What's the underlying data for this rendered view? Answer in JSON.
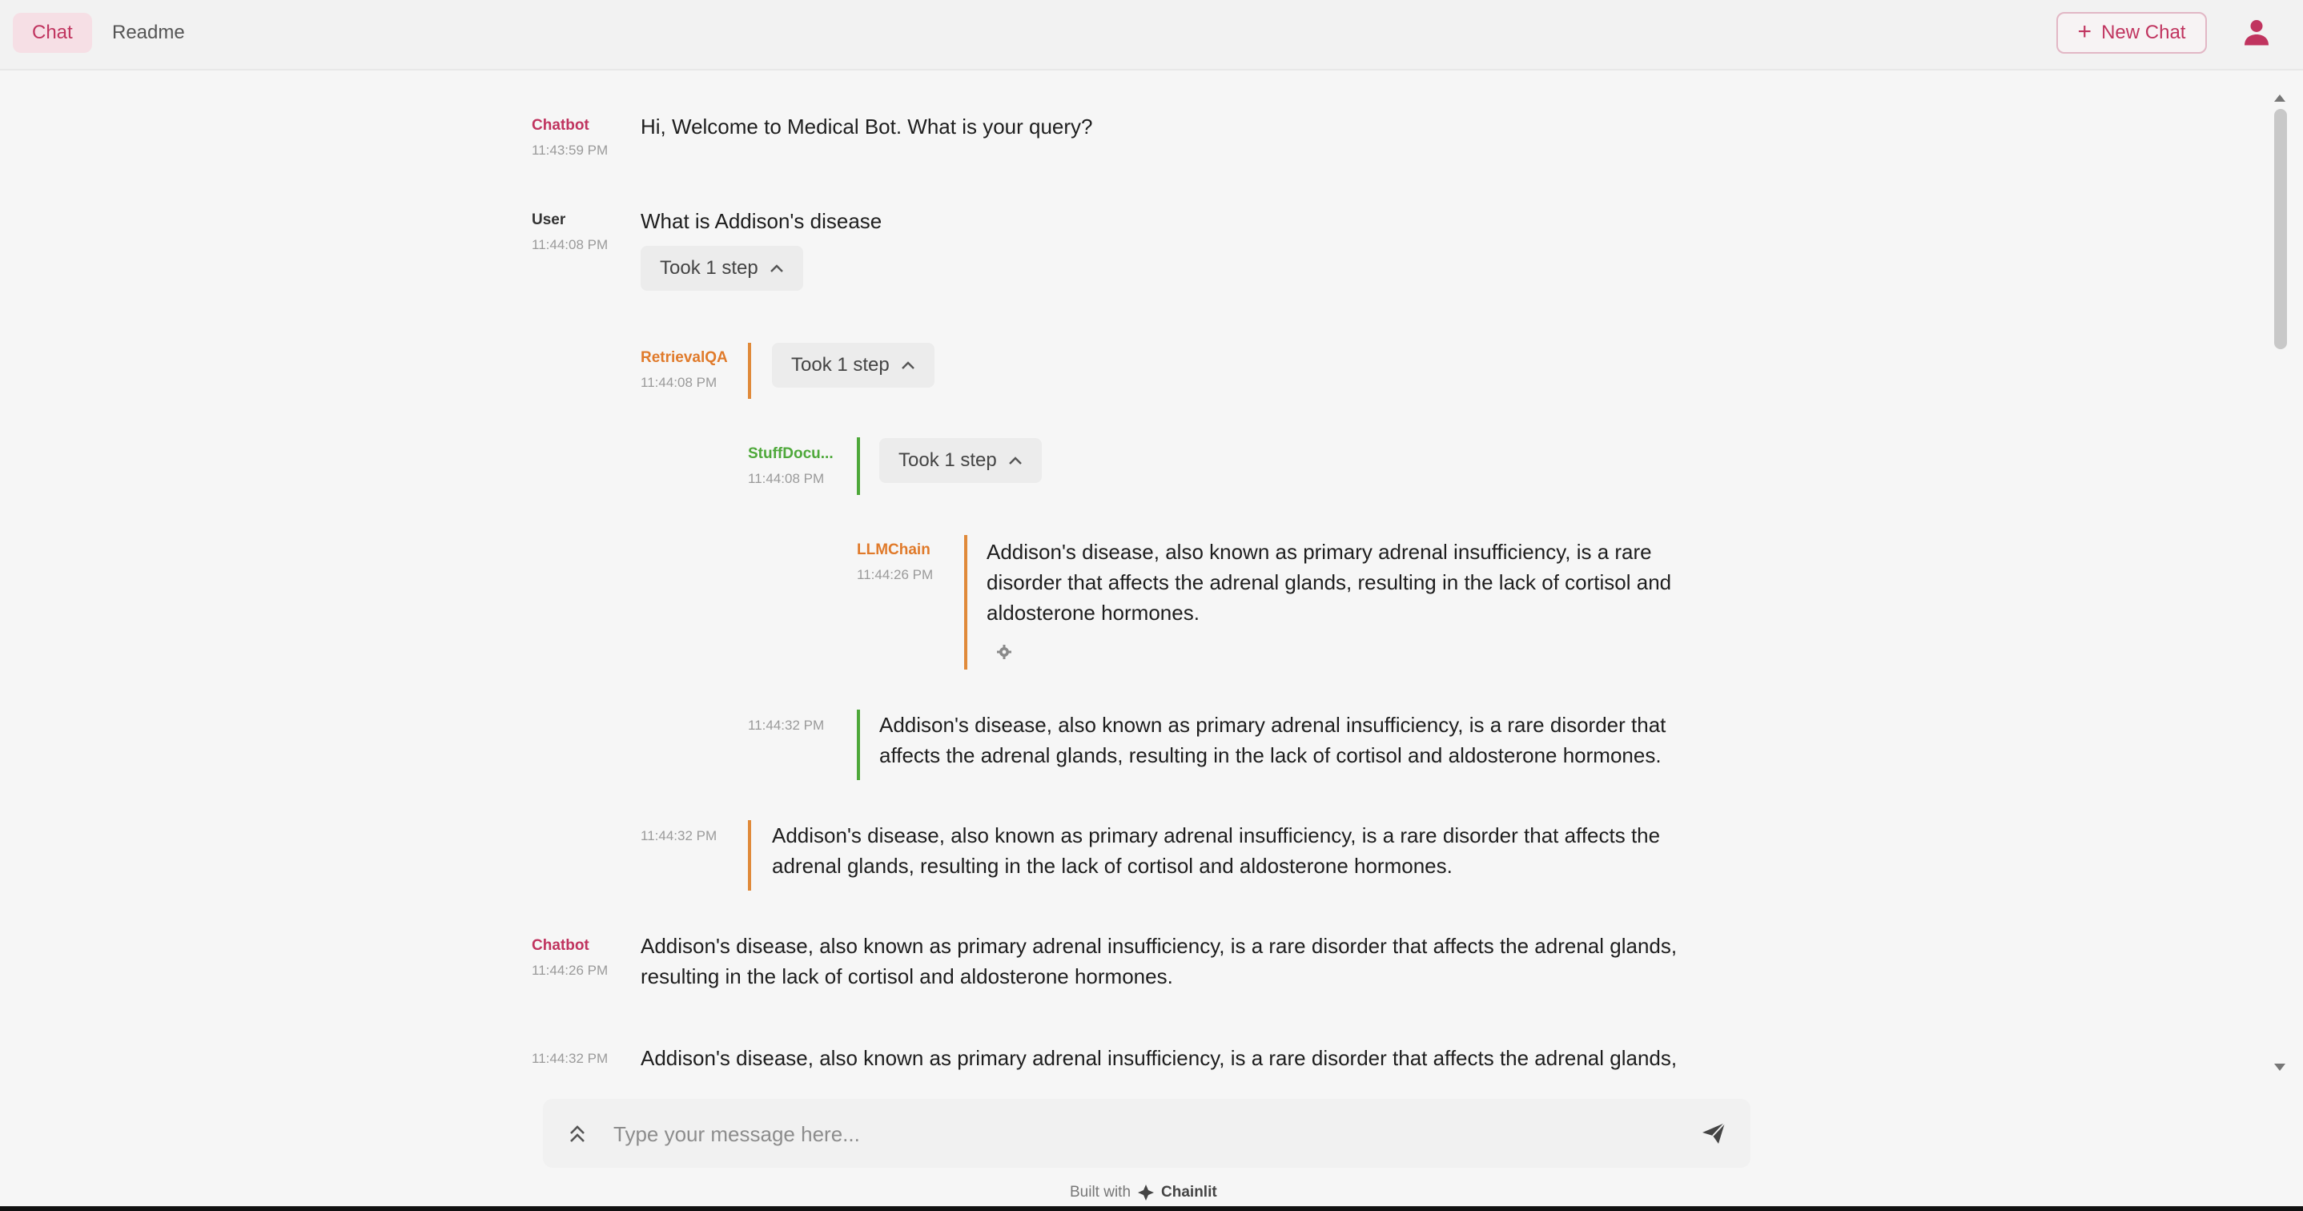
{
  "header": {
    "tabs": [
      {
        "label": "Chat",
        "active": true
      },
      {
        "label": "Readme",
        "active": false
      }
    ],
    "new_chat_label": "New Chat"
  },
  "messages": [
    {
      "author": "Chatbot",
      "time": "11:43:59 PM",
      "text": "Hi, Welcome to Medical Bot. What is your query?"
    },
    {
      "author": "User",
      "time": "11:44:08 PM",
      "text": "What is Addison's disease",
      "step_label": "Took 1 step"
    },
    {
      "author": "RetrievalQA",
      "time": "11:44:08 PM",
      "step_label": "Took 1 step"
    },
    {
      "author": "StuffDocu...",
      "time": "11:44:08 PM",
      "step_label": "Took 1 step"
    },
    {
      "author": "LLMChain",
      "time": "11:44:26 PM",
      "text": "Addison's disease, also known as primary adrenal insufficiency, is a rare disorder that affects the adrenal glands, resulting in the lack of cortisol and aldosterone hormones."
    },
    {
      "author": "",
      "time": "11:44:32 PM",
      "text": "Addison's disease, also known as primary adrenal insufficiency, is a rare disorder that affects the adrenal glands, resulting in the lack of cortisol and aldosterone hormones."
    },
    {
      "author": "",
      "time": "11:44:32 PM",
      "text": "Addison's disease, also known as primary adrenal insufficiency, is a rare disorder that affects the adrenal glands, resulting in the lack of cortisol and aldosterone hormones."
    },
    {
      "author": "Chatbot",
      "time": "11:44:26 PM",
      "text": "Addison's disease, also known as primary adrenal insufficiency, is a rare disorder that affects the adrenal glands, resulting in the lack of cortisol and aldosterone hormones."
    },
    {
      "author": "",
      "time": "11:44:32 PM",
      "text": "Addison's disease, also known as primary adrenal insufficiency, is a rare disorder that affects the adrenal glands,"
    }
  ],
  "composer": {
    "placeholder": "Type your message here..."
  },
  "footer": {
    "built_with": "Built with",
    "brand": "Chainlit"
  },
  "colors": {
    "accent": "#c0345f",
    "chain_orange": "#e08a3a",
    "chain_green": "#4ea83a"
  },
  "icons": [
    "plus-icon",
    "user-icon",
    "chevron-up-icon",
    "gear-icon",
    "expand-icon",
    "send-icon",
    "chainlit-logo-icon"
  ]
}
